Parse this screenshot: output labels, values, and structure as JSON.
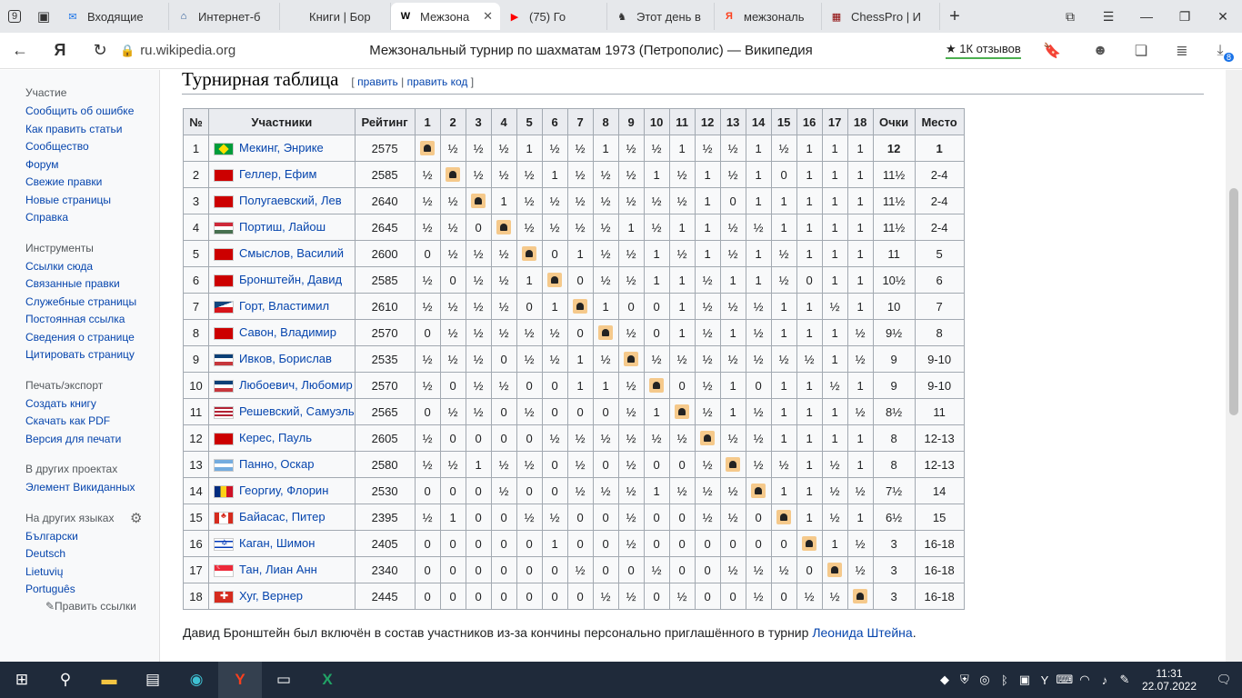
{
  "browser": {
    "tab_counter": "9",
    "tabs": [
      {
        "label": "Входящие",
        "icon": "mail-icon",
        "color": "#1a73e8"
      },
      {
        "label": "Интернет-б",
        "icon": "bank-icon",
        "color": "#1a4d8f"
      },
      {
        "label": "Книги | Бор",
        "icon": "book-icon",
        "color": "#888888"
      },
      {
        "label": "Межзона",
        "icon": "wikipedia-icon",
        "color": "#000000",
        "active": true
      },
      {
        "label": "(75) Го",
        "icon": "youtube-icon",
        "color": "#ff0000"
      },
      {
        "label": "Этот день в",
        "icon": "chess-icon",
        "color": "#333333"
      },
      {
        "label": "межзональ",
        "icon": "yandex-icon",
        "color": "#fc3f1d"
      },
      {
        "label": "ChessPro | И",
        "icon": "chessboard-icon",
        "color": "#8b0000"
      }
    ],
    "url": "ru.wikipedia.org",
    "page_title": "Межзональный турнир по шахматам 1973 (Петрополис) — Википедия",
    "reviews": "★ 1К отзывов",
    "downloads_badge": "8"
  },
  "sidebar": {
    "sections": [
      {
        "title": "Участие",
        "items": [
          "Сообщить об ошибке",
          "Как править статьи",
          "Сообщество",
          "Форум",
          "Свежие правки",
          "Новые страницы",
          "Справка"
        ]
      },
      {
        "title": "Инструменты",
        "items": [
          "Ссылки сюда",
          "Связанные правки",
          "Служебные страницы",
          "Постоянная ссылка",
          "Сведения о странице",
          "Цитировать страницу"
        ]
      },
      {
        "title": "Печать/экспорт",
        "items": [
          "Создать книгу",
          "Скачать как PDF",
          "Версия для печати"
        ]
      },
      {
        "title": "В других проектах",
        "items": [
          "Элемент Викиданных"
        ]
      },
      {
        "title": "На других языках",
        "items": [
          "Български",
          "Deutsch",
          "Lietuvių",
          "Português"
        ]
      }
    ],
    "edit_links": "✎Править ссылки"
  },
  "section": {
    "title": "Турнирная таблица",
    "edit": "править",
    "edit_code": "править код",
    "open_bracket": "[",
    "sep": "|",
    "close_bracket": "]"
  },
  "table": {
    "headers": [
      "№",
      "Участники",
      "Рейтинг",
      "1",
      "2",
      "3",
      "4",
      "5",
      "6",
      "7",
      "8",
      "9",
      "10",
      "11",
      "12",
      "13",
      "14",
      "15",
      "16",
      "17",
      "18",
      "Очки",
      "Место"
    ],
    "rows": [
      {
        "n": "1",
        "flag": "br",
        "name": "Мекинг, Энрике",
        "rating": "2575",
        "res": [
          "X",
          "½",
          "½",
          "½",
          "1",
          "½",
          "½",
          "1",
          "½",
          "½",
          "1",
          "½",
          "½",
          "1",
          "½",
          "1",
          "1",
          "1"
        ],
        "pts": "12",
        "place": "1"
      },
      {
        "n": "2",
        "flag": "su",
        "name": "Геллер, Ефим",
        "rating": "2585",
        "res": [
          "½",
          "X",
          "½",
          "½",
          "½",
          "1",
          "½",
          "½",
          "½",
          "1",
          "½",
          "1",
          "½",
          "1",
          "0",
          "1",
          "1",
          "1"
        ],
        "pts": "11½",
        "place": "2-4"
      },
      {
        "n": "3",
        "flag": "su",
        "name": "Полугаевский, Лев",
        "rating": "2640",
        "res": [
          "½",
          "½",
          "X",
          "1",
          "½",
          "½",
          "½",
          "½",
          "½",
          "½",
          "½",
          "1",
          "0",
          "1",
          "1",
          "1",
          "1",
          "1"
        ],
        "pts": "11½",
        "place": "2-4"
      },
      {
        "n": "4",
        "flag": "hu",
        "name": "Портиш, Лайош",
        "rating": "2645",
        "res": [
          "½",
          "½",
          "0",
          "X",
          "½",
          "½",
          "½",
          "½",
          "1",
          "½",
          "1",
          "1",
          "½",
          "½",
          "1",
          "1",
          "1",
          "1"
        ],
        "pts": "11½",
        "place": "2-4"
      },
      {
        "n": "5",
        "flag": "su",
        "name": "Смыслов, Василий",
        "rating": "2600",
        "res": [
          "0",
          "½",
          "½",
          "½",
          "X",
          "0",
          "1",
          "½",
          "½",
          "1",
          "½",
          "1",
          "½",
          "1",
          "½",
          "1",
          "1",
          "1"
        ],
        "pts": "11",
        "place": "5"
      },
      {
        "n": "6",
        "flag": "su",
        "name": "Бронштейн, Давид",
        "rating": "2585",
        "res": [
          "½",
          "0",
          "½",
          "½",
          "1",
          "X",
          "0",
          "½",
          "½",
          "1",
          "1",
          "½",
          "1",
          "1",
          "½",
          "0",
          "1",
          "1"
        ],
        "pts": "10½",
        "place": "6"
      },
      {
        "n": "7",
        "flag": "cz",
        "name": "Горт, Властимил",
        "rating": "2610",
        "res": [
          "½",
          "½",
          "½",
          "½",
          "0",
          "1",
          "X",
          "1",
          "0",
          "0",
          "1",
          "½",
          "½",
          "½",
          "1",
          "1",
          "½",
          "1"
        ],
        "pts": "10",
        "place": "7"
      },
      {
        "n": "8",
        "flag": "su",
        "name": "Савон, Владимир",
        "rating": "2570",
        "res": [
          "0",
          "½",
          "½",
          "½",
          "½",
          "½",
          "0",
          "X",
          "½",
          "0",
          "1",
          "½",
          "1",
          "½",
          "1",
          "1",
          "1",
          "½"
        ],
        "pts": "9½",
        "place": "8"
      },
      {
        "n": "9",
        "flag": "yu",
        "name": "Ивков, Борислав",
        "rating": "2535",
        "res": [
          "½",
          "½",
          "½",
          "0",
          "½",
          "½",
          "1",
          "½",
          "X",
          "½",
          "½",
          "½",
          "½",
          "½",
          "½",
          "½",
          "1",
          "½"
        ],
        "pts": "9",
        "place": "9-10"
      },
      {
        "n": "10",
        "flag": "yu",
        "name": "Любоевич, Любомир",
        "rating": "2570",
        "res": [
          "½",
          "0",
          "½",
          "½",
          "0",
          "0",
          "1",
          "1",
          "½",
          "X",
          "0",
          "½",
          "1",
          "0",
          "1",
          "1",
          "½",
          "1"
        ],
        "pts": "9",
        "place": "9-10"
      },
      {
        "n": "11",
        "flag": "us",
        "name": "Решевский, Самуэль",
        "rating": "2565",
        "res": [
          "0",
          "½",
          "½",
          "0",
          "½",
          "0",
          "0",
          "0",
          "½",
          "1",
          "X",
          "½",
          "1",
          "½",
          "1",
          "1",
          "1",
          "½"
        ],
        "pts": "8½",
        "place": "11"
      },
      {
        "n": "12",
        "flag": "su",
        "name": "Керес, Пауль",
        "rating": "2605",
        "res": [
          "½",
          "0",
          "0",
          "0",
          "0",
          "½",
          "½",
          "½",
          "½",
          "½",
          "½",
          "X",
          "½",
          "½",
          "1",
          "1",
          "1",
          "1"
        ],
        "pts": "8",
        "place": "12-13"
      },
      {
        "n": "13",
        "flag": "ar",
        "name": "Панно, Оскар",
        "rating": "2580",
        "res": [
          "½",
          "½",
          "1",
          "½",
          "½",
          "0",
          "½",
          "0",
          "½",
          "0",
          "0",
          "½",
          "X",
          "½",
          "½",
          "1",
          "½",
          "1"
        ],
        "pts": "8",
        "place": "12-13"
      },
      {
        "n": "14",
        "flag": "ro",
        "name": "Георгиу, Флорин",
        "rating": "2530",
        "res": [
          "0",
          "0",
          "0",
          "½",
          "0",
          "0",
          "½",
          "½",
          "½",
          "1",
          "½",
          "½",
          "½",
          "X",
          "1",
          "1",
          "½",
          "½"
        ],
        "pts": "7½",
        "place": "14"
      },
      {
        "n": "15",
        "flag": "ca",
        "name": "Байасас, Питер",
        "rating": "2395",
        "res": [
          "½",
          "1",
          "0",
          "0",
          "½",
          "½",
          "0",
          "0",
          "½",
          "0",
          "0",
          "½",
          "½",
          "0",
          "X",
          "1",
          "½",
          "1"
        ],
        "pts": "6½",
        "place": "15"
      },
      {
        "n": "16",
        "flag": "il",
        "name": "Каган, Шимон",
        "rating": "2405",
        "res": [
          "0",
          "0",
          "0",
          "0",
          "0",
          "1",
          "0",
          "0",
          "½",
          "0",
          "0",
          "0",
          "0",
          "0",
          "0",
          "X",
          "1",
          "½"
        ],
        "pts": "3",
        "place": "16-18"
      },
      {
        "n": "17",
        "flag": "sg",
        "name": "Тан, Лиан Анн",
        "rating": "2340",
        "res": [
          "0",
          "0",
          "0",
          "0",
          "0",
          "0",
          "½",
          "0",
          "0",
          "½",
          "0",
          "0",
          "½",
          "½",
          "½",
          "0",
          "X",
          "½"
        ],
        "pts": "3",
        "place": "16-18"
      },
      {
        "n": "18",
        "flag": "ch",
        "name": "Хуг, Вернер",
        "rating": "2445",
        "res": [
          "0",
          "0",
          "0",
          "0",
          "0",
          "0",
          "0",
          "½",
          "½",
          "0",
          "½",
          "0",
          "0",
          "½",
          "0",
          "½",
          "½",
          "X"
        ],
        "pts": "3",
        "place": "16-18"
      }
    ]
  },
  "note": {
    "text": "Давид Бронштейн был включён в состав участников из-за кончины персонально приглашённого в турнир ",
    "link": "Леонида Штейна",
    "end": "."
  },
  "taskbar": {
    "time": "11:31",
    "date": "22.07.2022"
  }
}
